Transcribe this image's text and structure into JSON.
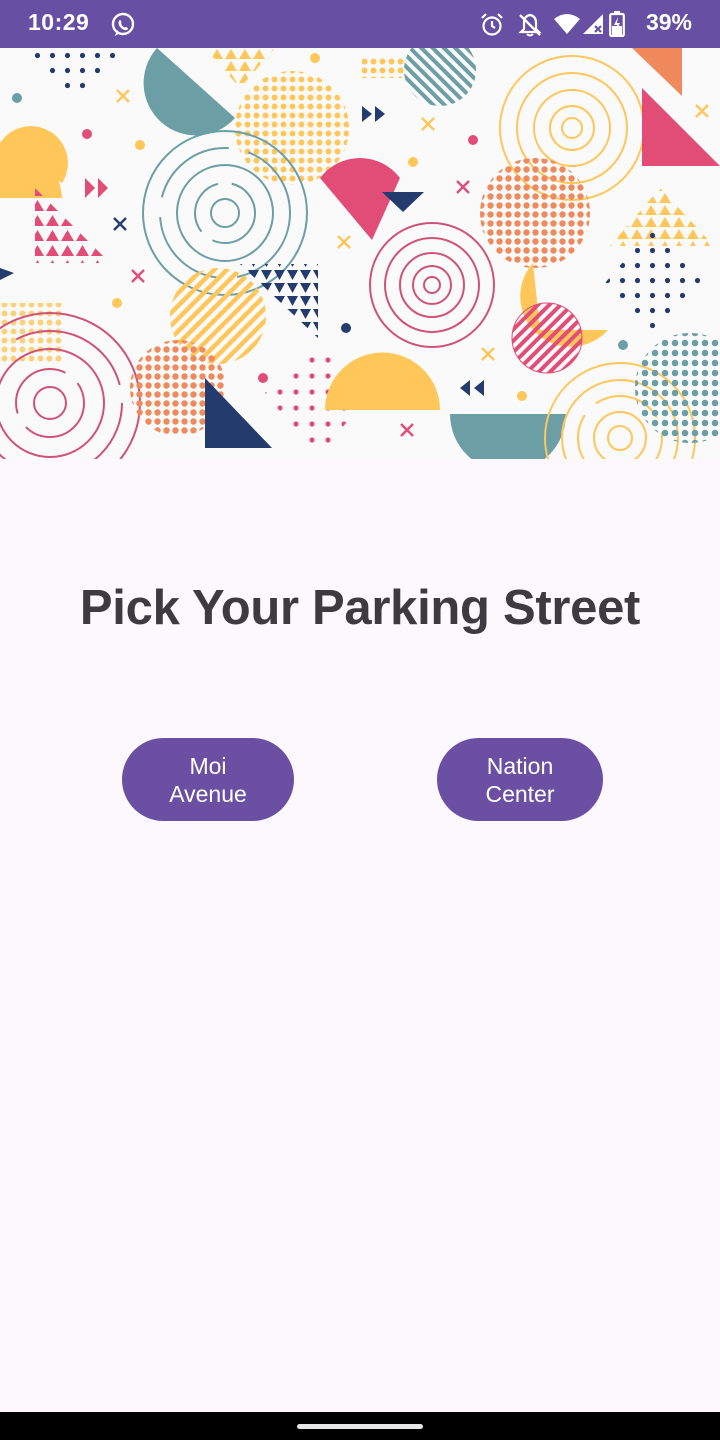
{
  "status_bar": {
    "time": "10:29",
    "battery_percent": "39%",
    "background": "#674fa3",
    "icons": [
      "whatsapp-icon",
      "alarm-icon",
      "notifications-off-icon",
      "wifi-icon",
      "cell-signal-icon",
      "battery-icon"
    ]
  },
  "banner": {
    "description_icon": "abstract-geometric-banner",
    "colors": [
      "#e24d78",
      "#ffc65a",
      "#6c9ea5",
      "#f08a5d",
      "#243b6e"
    ]
  },
  "main": {
    "title": "Pick Your Parking Street"
  },
  "streets": {
    "moi_label": "Moi Avenue",
    "nation_label": "Nation Center",
    "button_color": "#6b4fa3"
  }
}
